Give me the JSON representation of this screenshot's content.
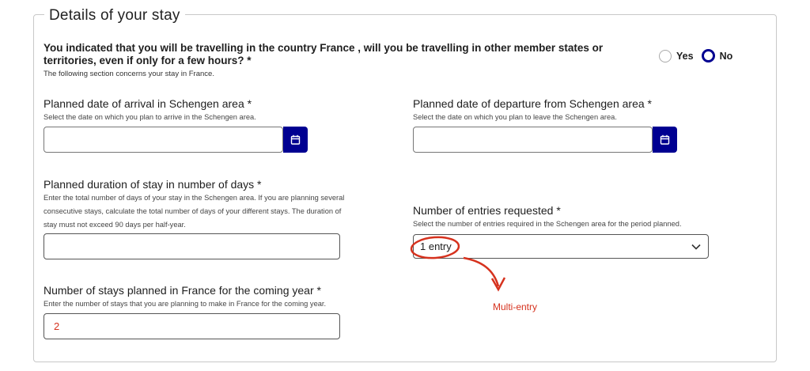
{
  "section": {
    "legend": "Details of your stay"
  },
  "question": {
    "text": "You indicated that you will be travelling in the country France , will you be travelling in other member states or territories, even if only for a few hours? *",
    "note": "The following section concerns your stay in France.",
    "options": [
      {
        "label": "Yes",
        "checked": false
      },
      {
        "label": "No",
        "checked": true
      }
    ]
  },
  "arrival": {
    "label": "Planned date of arrival in Schengen area *",
    "hint": "Select the date on which you plan to arrive in the Schengen area.",
    "value": ""
  },
  "departure": {
    "label": "Planned date of departure from Schengen area *",
    "hint": "Select the date on which you plan to leave the Schengen area.",
    "value": ""
  },
  "duration": {
    "label": "Planned duration of stay in number of days *",
    "hint_lines": [
      "Enter the total number of days of your stay in the Schengen area. If you are planning several",
      "consecutive stays, calculate the total number of days of your different stays. The duration of",
      "stay must not exceed 90 days per half-year."
    ],
    "value": ""
  },
  "entries": {
    "label": "Number of entries requested *",
    "hint": "Select the number of entries required in the Schengen area for the period planned.",
    "selected": "1 entry"
  },
  "stays": {
    "label": "Number of stays planned in France for the coming year *",
    "hint": "Enter the number of stays that you are planning to make in France for the coming year.",
    "value": "2"
  },
  "annotation": {
    "text": "Multi-entry",
    "color": "#d6321e"
  },
  "colors": {
    "accent": "#000091",
    "annotation": "#d6321e"
  },
  "icons": {
    "calendar": "calendar-icon",
    "chevron": "chevron-down-icon"
  }
}
